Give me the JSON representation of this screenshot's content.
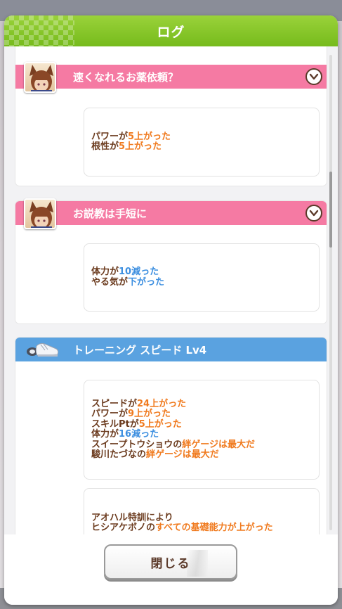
{
  "dialog": {
    "title": "ログ"
  },
  "colors": {
    "header_green": "#86c52a",
    "pink_header": "#f57aa3",
    "blue_header": "#5aa2e0",
    "orange": "#f07a1e",
    "blue": "#3d8fe0",
    "brown": "#6b3b1e"
  },
  "events": [
    {
      "title": "速くなれるお薬依頼？",
      "header_color": "pink",
      "icon": "character-portrait",
      "messages": [
        {
          "lines": [
            {
              "parts": [
                {
                  "t": "パワーが"
                },
                {
                  "t": "5上がった",
                  "c": "o"
                }
              ]
            },
            {
              "parts": [
                {
                  "t": "根性が"
                },
                {
                  "t": "5上がった",
                  "c": "o"
                }
              ]
            }
          ]
        }
      ]
    },
    {
      "title": "お説教は手短に",
      "header_color": "pink",
      "icon": "character-portrait",
      "messages": [
        {
          "lines": [
            {
              "parts": [
                {
                  "t": "体力が"
                },
                {
                  "t": "10減った",
                  "c": "b"
                }
              ]
            },
            {
              "parts": [
                {
                  "t": "やる気が"
                },
                {
                  "t": "下がった",
                  "c": "b"
                }
              ]
            }
          ]
        }
      ]
    },
    {
      "title": "トレーニング スピード Lv4",
      "header_color": "blue",
      "icon": "shoe-icon",
      "messages": [
        {
          "lines": [
            {
              "parts": [
                {
                  "t": "スピードが"
                },
                {
                  "t": "24上がった",
                  "c": "o"
                }
              ]
            },
            {
              "parts": [
                {
                  "t": "パワーが"
                },
                {
                  "t": "9上がった",
                  "c": "o"
                }
              ]
            },
            {
              "parts": [
                {
                  "t": "スキルPtが"
                },
                {
                  "t": "5上がった",
                  "c": "o"
                }
              ]
            },
            {
              "parts": [
                {
                  "t": "体力が"
                },
                {
                  "t": "16減った",
                  "c": "b"
                }
              ]
            },
            {
              "parts": [
                {
                  "t": "スイープトウショウの"
                },
                {
                  "t": "絆ゲージは最大だ",
                  "c": "o"
                }
              ]
            },
            {
              "parts": [
                {
                  "t": "駿川たづなの"
                },
                {
                  "t": "絆ゲージは最大だ",
                  "c": "o"
                }
              ]
            }
          ]
        },
        {
          "lines": [
            {
              "parts": [
                {
                  "t": "アオハル特訓により"
                }
              ]
            },
            {
              "parts": [
                {
                  "t": "ヒシアケボノの"
                },
                {
                  "t": "すべての基礎能力が上がった",
                  "c": "o"
                }
              ]
            }
          ]
        }
      ]
    }
  ],
  "footer": {
    "close_label": "閉じる"
  }
}
